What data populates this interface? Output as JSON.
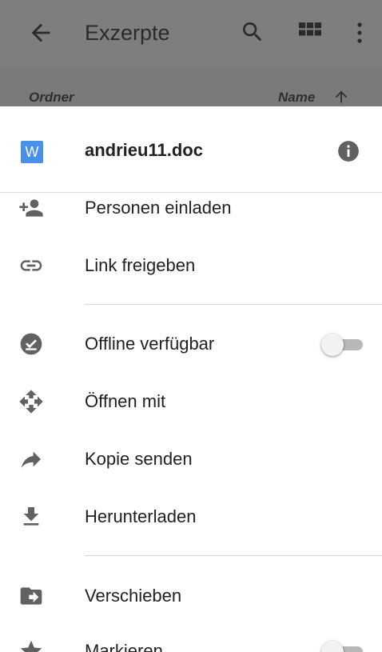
{
  "appbar": {
    "title": "Exzerpte",
    "back_icon": "arrow-back-icon",
    "search_icon": "search-icon",
    "grid_icon": "grid-view-icon",
    "more_icon": "more-vert-icon"
  },
  "sortbar": {
    "folders_label": "Ordner",
    "name_label": "Name"
  },
  "sheet": {
    "file_icon_letter": "W",
    "file_name": "andrieu11.doc",
    "items": [
      {
        "label": "Personen einladen",
        "icon": "person-add-icon"
      },
      {
        "label": "Link freigeben",
        "icon": "link-icon"
      },
      {
        "label": "Offline verfügbar",
        "icon": "offline-check-icon",
        "toggle": false
      },
      {
        "label": "Öffnen mit",
        "icon": "open-with-icon"
      },
      {
        "label": "Kopie senden",
        "icon": "share-forward-icon"
      },
      {
        "label": "Herunterladen",
        "icon": "download-icon"
      },
      {
        "label": "Verschieben",
        "icon": "move-folder-icon"
      },
      {
        "label": "Markieren",
        "icon": "star-icon",
        "toggle": false
      }
    ]
  },
  "colors": {
    "scrim": "#7a7a7a",
    "word_blue": "#4a8fe8",
    "icon_gray": "#616161"
  }
}
